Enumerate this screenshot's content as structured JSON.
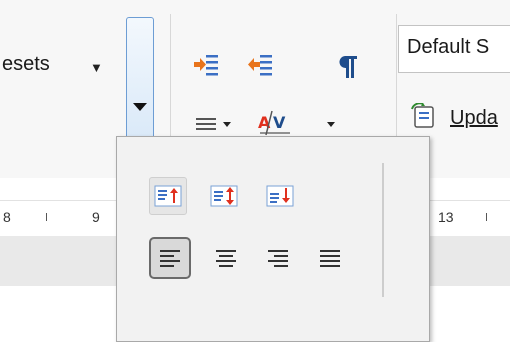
{
  "toolbar": {
    "presets_label": "esets",
    "presets_arrow": "▼",
    "paragraph_style_value": "Default S",
    "update_label": "Upda"
  },
  "ruler": {
    "numbers": [
      "8",
      "9",
      "13"
    ]
  },
  "popup": {
    "vertical_alignment_buttons": [
      "align-top",
      "align-center-vertical",
      "align-bottom"
    ],
    "horizontal_alignment_buttons": [
      "align-left",
      "align-center",
      "align-right",
      "justify"
    ]
  },
  "colors": {
    "accent_blue": "#3b6fc4",
    "accent_red": "#e0301e",
    "accent_orange": "#e8741c",
    "dropdown_border": "#6d9dd4"
  }
}
